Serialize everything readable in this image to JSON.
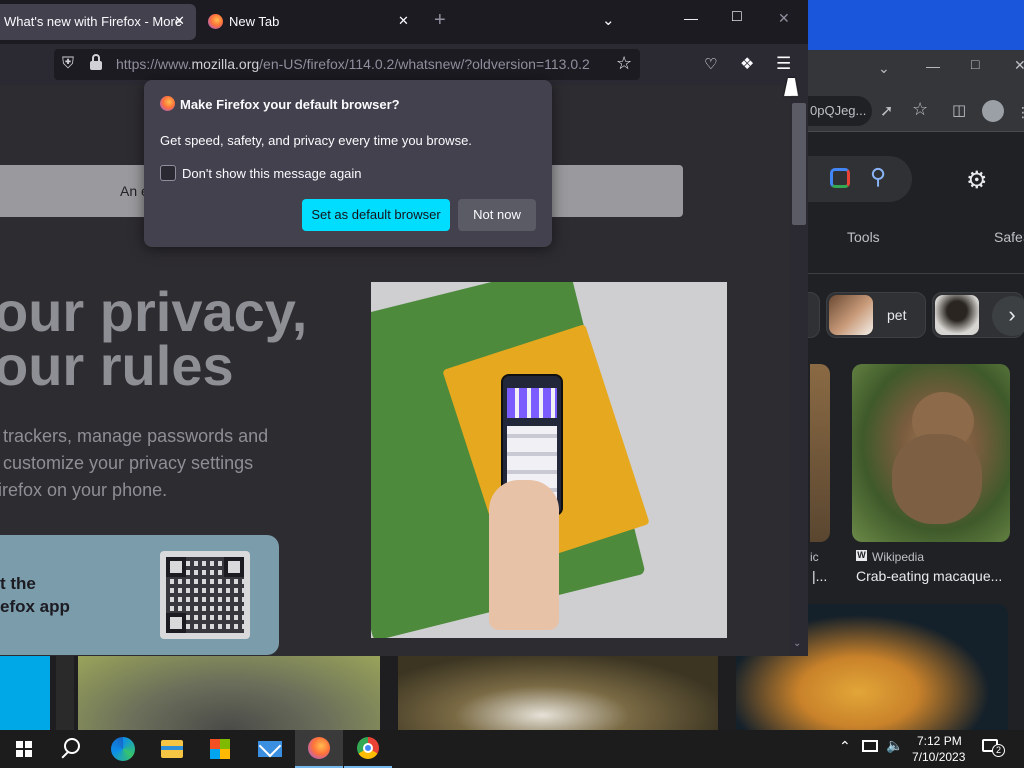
{
  "chrome": {
    "omnibox_text": "0pQJeg...",
    "tools_label": "Tools",
    "safesearch_label": "SafeS",
    "chip_label": "pet",
    "card_source": "Wikipedia",
    "card_title": "Crab-eating macaque...",
    "card_fragment_source": "ic",
    "card_fragment_title": "|..."
  },
  "firefox": {
    "tabs": [
      {
        "label": "What's new with Firefox - More"
      },
      {
        "label": "New Tab"
      }
    ],
    "url": {
      "prefix": "https://www.",
      "domain": "mozilla.org",
      "path": "/en-US/firefox/114.0.2/whatsnew/?oldversion=113.0.2"
    },
    "page": {
      "banner_text": "An e",
      "hero_line1": "our privacy,",
      "hero_line2": "our rules",
      "para_line1": " trackers, manage passwords and",
      "para_line2": " customize your privacy settings",
      "para_line3": "irefox on your phone.",
      "cta_line1": "t the",
      "cta_line2": "efox app"
    },
    "popup": {
      "title": "Make Firefox your default browser?",
      "body": "Get speed, safety, and privacy every time you browse.",
      "checkbox_label": "Don't show this message again",
      "primary_button": "Set as default browser",
      "secondary_button": "Not now"
    }
  },
  "taskbar": {
    "time": "7:12 PM",
    "date": "7/10/2023",
    "notification_count": "2"
  },
  "colors": {
    "firefox_accent": "#00ddff",
    "chrome_blue": "#1a56db",
    "taskbar": "#1c1c1c"
  }
}
